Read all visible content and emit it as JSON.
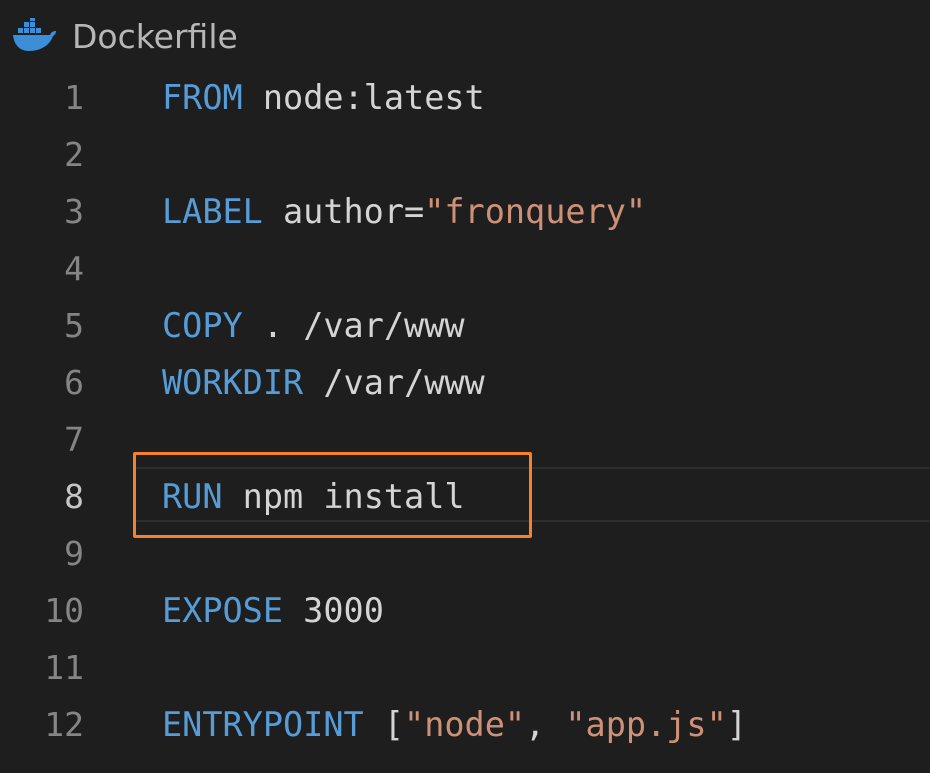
{
  "tab": {
    "icon": "docker-whale-icon",
    "filename": "Dockerfile"
  },
  "colors": {
    "background": "#1e1e1e",
    "keyword": "#569cd6",
    "text": "#d4d4d4",
    "string": "#ce9178",
    "line_number": "#858585",
    "highlight_box": "#f5822a"
  },
  "active_line": 8,
  "highlighted_line": 8,
  "lines": [
    {
      "number": "1",
      "tokens": [
        {
          "t": "FROM",
          "k": "kw"
        },
        {
          "t": " node:latest",
          "k": "txt"
        }
      ]
    },
    {
      "number": "2",
      "tokens": []
    },
    {
      "number": "3",
      "tokens": [
        {
          "t": "LABEL",
          "k": "kw"
        },
        {
          "t": " author=",
          "k": "txt"
        },
        {
          "t": "\"fronquery\"",
          "k": "str"
        }
      ]
    },
    {
      "number": "4",
      "tokens": []
    },
    {
      "number": "5",
      "tokens": [
        {
          "t": "COPY",
          "k": "kw"
        },
        {
          "t": " . /var/www",
          "k": "txt"
        }
      ]
    },
    {
      "number": "6",
      "tokens": [
        {
          "t": "WORKDIR",
          "k": "kw"
        },
        {
          "t": " /var/www",
          "k": "txt"
        }
      ]
    },
    {
      "number": "7",
      "tokens": []
    },
    {
      "number": "8",
      "tokens": [
        {
          "t": "RUN",
          "k": "kw"
        },
        {
          "t": " npm install",
          "k": "txt"
        }
      ]
    },
    {
      "number": "9",
      "tokens": []
    },
    {
      "number": "10",
      "tokens": [
        {
          "t": "EXPOSE",
          "k": "kw"
        },
        {
          "t": " 3000",
          "k": "txt"
        }
      ]
    },
    {
      "number": "11",
      "tokens": []
    },
    {
      "number": "12",
      "tokens": [
        {
          "t": "ENTRYPOINT",
          "k": "kw"
        },
        {
          "t": " [",
          "k": "txt"
        },
        {
          "t": "\"node\"",
          "k": "str"
        },
        {
          "t": ", ",
          "k": "txt"
        },
        {
          "t": "\"app.js\"",
          "k": "str"
        },
        {
          "t": "]",
          "k": "txt"
        }
      ]
    }
  ]
}
